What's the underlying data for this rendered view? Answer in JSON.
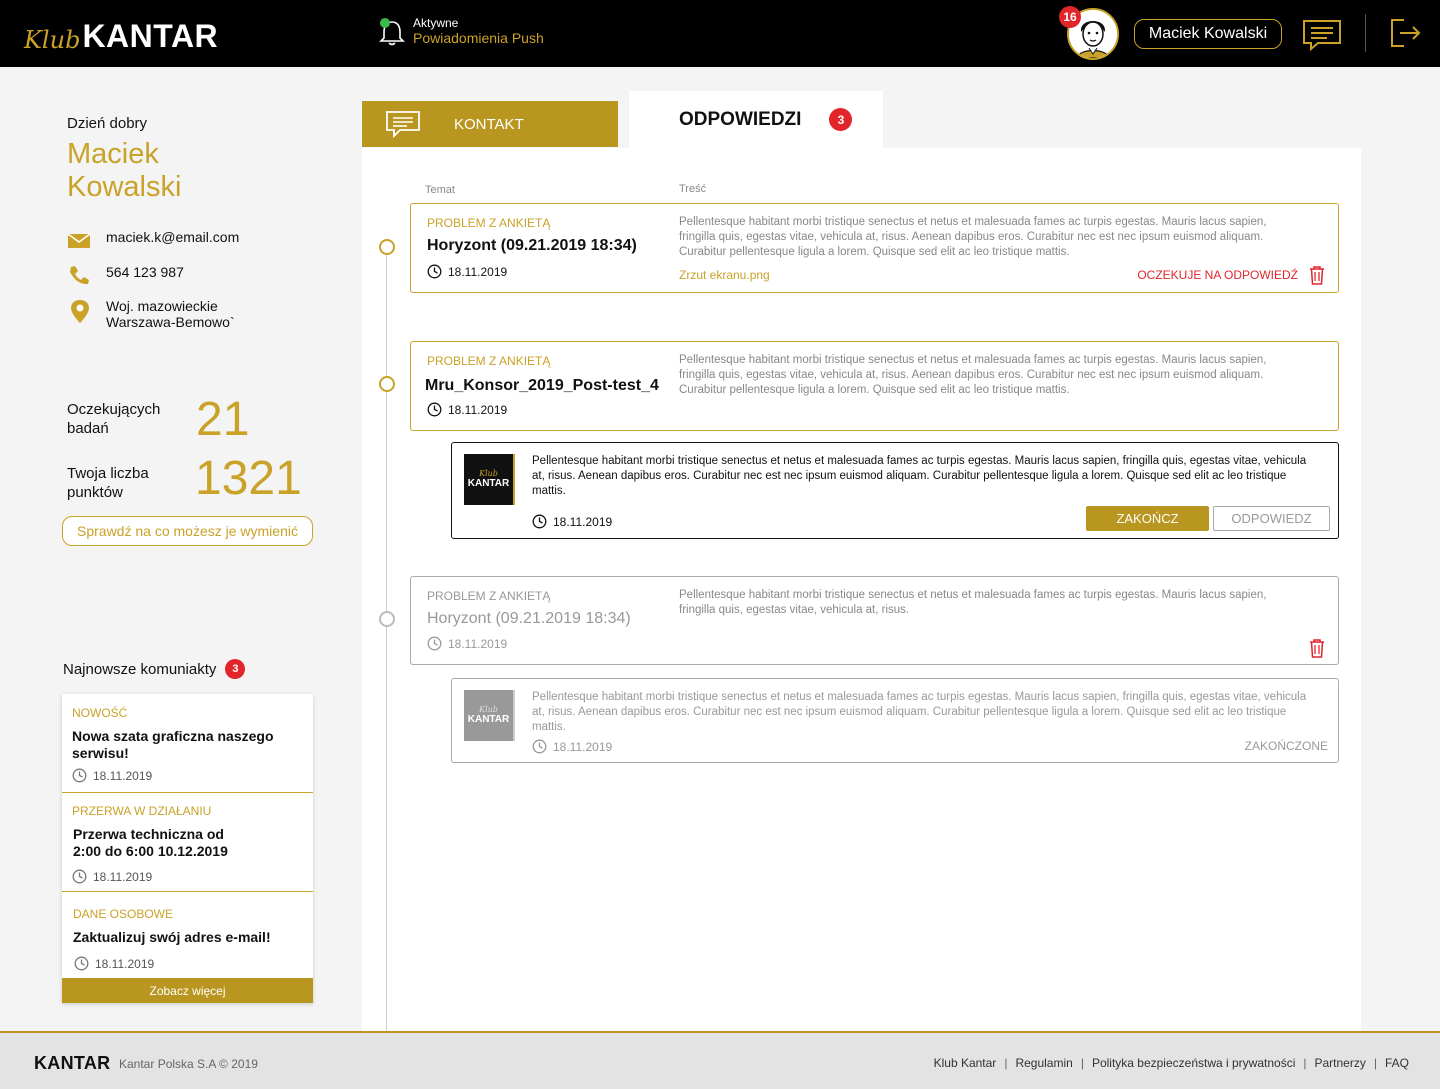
{
  "header": {
    "logo_klub": "Klub",
    "logo_kantar": "KANTAR",
    "push_status": "Aktywne",
    "push_label": "Powiadomienia Push",
    "avatar_badge": "16",
    "user_name": "Maciek Kowalski"
  },
  "profile": {
    "greeting": "Dzień dobry",
    "name": "Maciek Kowalski",
    "email": "maciek.k@email.com",
    "phone": "564 123 987",
    "address_line1": "Woj. mazowieckie",
    "address_line2": "Warszawa-Bemowo`"
  },
  "stats": {
    "pending_label": "Oczekujących badań",
    "pending_value": "21",
    "points_label": "Twoja liczba punktów",
    "points_value": "1321",
    "exchange_button": "Sprawdź na co możesz je wymienić"
  },
  "news": {
    "title": "Najnowsze komuniakty",
    "count": "3",
    "items": [
      {
        "category": "NOWOŚĆ",
        "title": "Nowa szata graficzna naszego serwisu!",
        "date": "18.11.2019"
      },
      {
        "category": "PRZERWA W DZIAŁANIU",
        "title": "Przerwa techniczna od 2:00 do 6:00 10.12.2019",
        "date": "18.11.2019"
      },
      {
        "category": "DANE OSOBOWE",
        "title": "Zaktualizuj swój adres e-mail!",
        "date": "18.11.2019"
      }
    ],
    "more_button": "Zobacz więcej"
  },
  "tabs": {
    "contact": "KONTAKT",
    "answers": "ODPOWIEDZI",
    "answers_count": "3"
  },
  "columns": {
    "subject": "Temat",
    "content": "Treść"
  },
  "tickets": [
    {
      "category": "PROBLEM Z ANKIETĄ",
      "title": "Horyzont (09.21.2019 18:34)",
      "date": "18.11.2019",
      "body": "Pellentesque habitant morbi tristique senectus et netus et malesuada fames ac turpis egestas. Mauris lacus sapien, fringilla quis, egestas vitae, vehicula at, risus. Aenean dapibus eros. Curabitur nec est nec ipsum euismod aliquam. Curabitur pellentesque ligula a lorem. Quisque sed elit ac leo tristique mattis.",
      "attachment": "Zrzut ekranu.png",
      "status": "OCZEKUJE NA ODPOWIEDŹ"
    },
    {
      "category": "PROBLEM Z ANKIETĄ",
      "title": "Mru_Konsor_2019_Post-test_4",
      "date": "18.11.2019",
      "body": "Pellentesque habitant morbi tristique senectus et netus et malesuada fames ac turpis egestas. Mauris lacus sapien, fringilla quis, egestas vitae, vehicula at, risus. Aenean dapibus eros. Curabitur nec est nec ipsum euismod aliquam. Curabitur pellentesque ligula a lorem. Quisque sed elit ac leo tristique mattis.",
      "reply": {
        "logo_klub": "Klub",
        "logo_kantar": "KANTAR",
        "body": "Pellentesque habitant morbi tristique senectus et netus et malesuada fames ac turpis egestas. Mauris lacus sapien, fringilla quis, egestas vitae, vehicula at, risus. Aenean dapibus eros. Curabitur nec est nec ipsum euismod aliquam. Curabitur pellentesque ligula a lorem. Quisque sed elit ac leo tristique mattis.",
        "date": "18.11.2019",
        "end_button": "ZAKOŃCZ",
        "reply_button": "ODPOWIEDZ"
      }
    },
    {
      "category": "PROBLEM Z ANKIETĄ",
      "title": "Horyzont (09.21.2019 18:34)",
      "date": "18.11.2019",
      "body": "Pellentesque habitant morbi tristique senectus et netus et malesuada fames ac turpis egestas. Mauris lacus sapien, fringilla quis, egestas vitae, vehicula at, risus.",
      "reply": {
        "logo_klub": "Klub",
        "logo_kantar": "KANTAR",
        "body": "Pellentesque habitant morbi tristique senectus et netus et malesuada fames ac turpis egestas. Mauris lacus sapien, fringilla quis, egestas vitae, vehicula at, risus. Aenean dapibus eros. Curabitur nec est nec ipsum euismod aliquam. Curabitur pellentesque ligula a lorem. Quisque sed elit ac leo tristique mattis.",
        "date": "18.11.2019",
        "status": "ZAKOŃCZONE"
      }
    }
  ],
  "footer": {
    "logo": "KANTAR",
    "copyright": "Kantar Polska S.A © 2019",
    "links": [
      "Klub Kantar",
      "Regulamin",
      "Polityka bezpieczeństwa i prywatności",
      "Partnerzy",
      "FAQ"
    ]
  },
  "colors": {
    "gold": "#c9a227",
    "gold_dark": "#b8961f",
    "red": "#e1252b",
    "black": "#000000"
  }
}
